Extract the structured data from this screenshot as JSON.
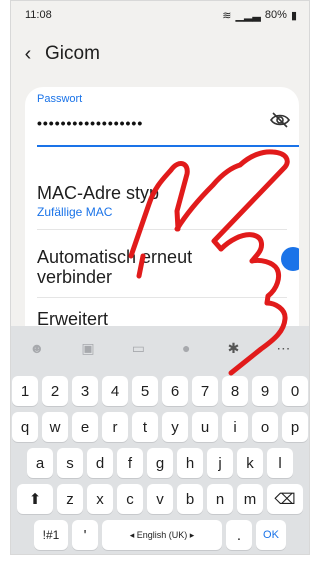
{
  "status": {
    "time": "11:08",
    "battery": "80%"
  },
  "header": {
    "title": "Gicom",
    "back_icon": "chevron-left-icon"
  },
  "form": {
    "password_label": "Passwort",
    "password_value": "••••••••••••••••••",
    "mac_title": "MAC-Adre     styp",
    "mac_sub": "Zufällige MAC",
    "auto_title_1": "Automatisch  erneut",
    "auto_title_2": "verbinder",
    "advanced": "Erweitert"
  },
  "keyboard": {
    "toolbar_icons": [
      "emoji-icon",
      "clipboard-icon",
      "gif-icon",
      "mic-icon",
      "gear-icon",
      "more-icon"
    ],
    "row1": [
      "1",
      "2",
      "3",
      "4",
      "5",
      "6",
      "7",
      "8",
      "9",
      "0"
    ],
    "row2": [
      "q",
      "w",
      "e",
      "r",
      "t",
      "y",
      "u",
      "i",
      "o",
      "p"
    ],
    "row3": [
      "a",
      "s",
      "d",
      "f",
      "g",
      "h",
      "j",
      "k",
      "l"
    ],
    "row4": [
      "z",
      "x",
      "c",
      "v",
      "b",
      "n",
      "m"
    ],
    "sym_label": "!#1",
    "apostrophe": "'",
    "space_label": "◂ English (UK) ▸",
    "dot": ".",
    "ok_label": "OK"
  },
  "colors": {
    "accent": "#1a73e8",
    "overlay_hand": "#e11b1b"
  }
}
